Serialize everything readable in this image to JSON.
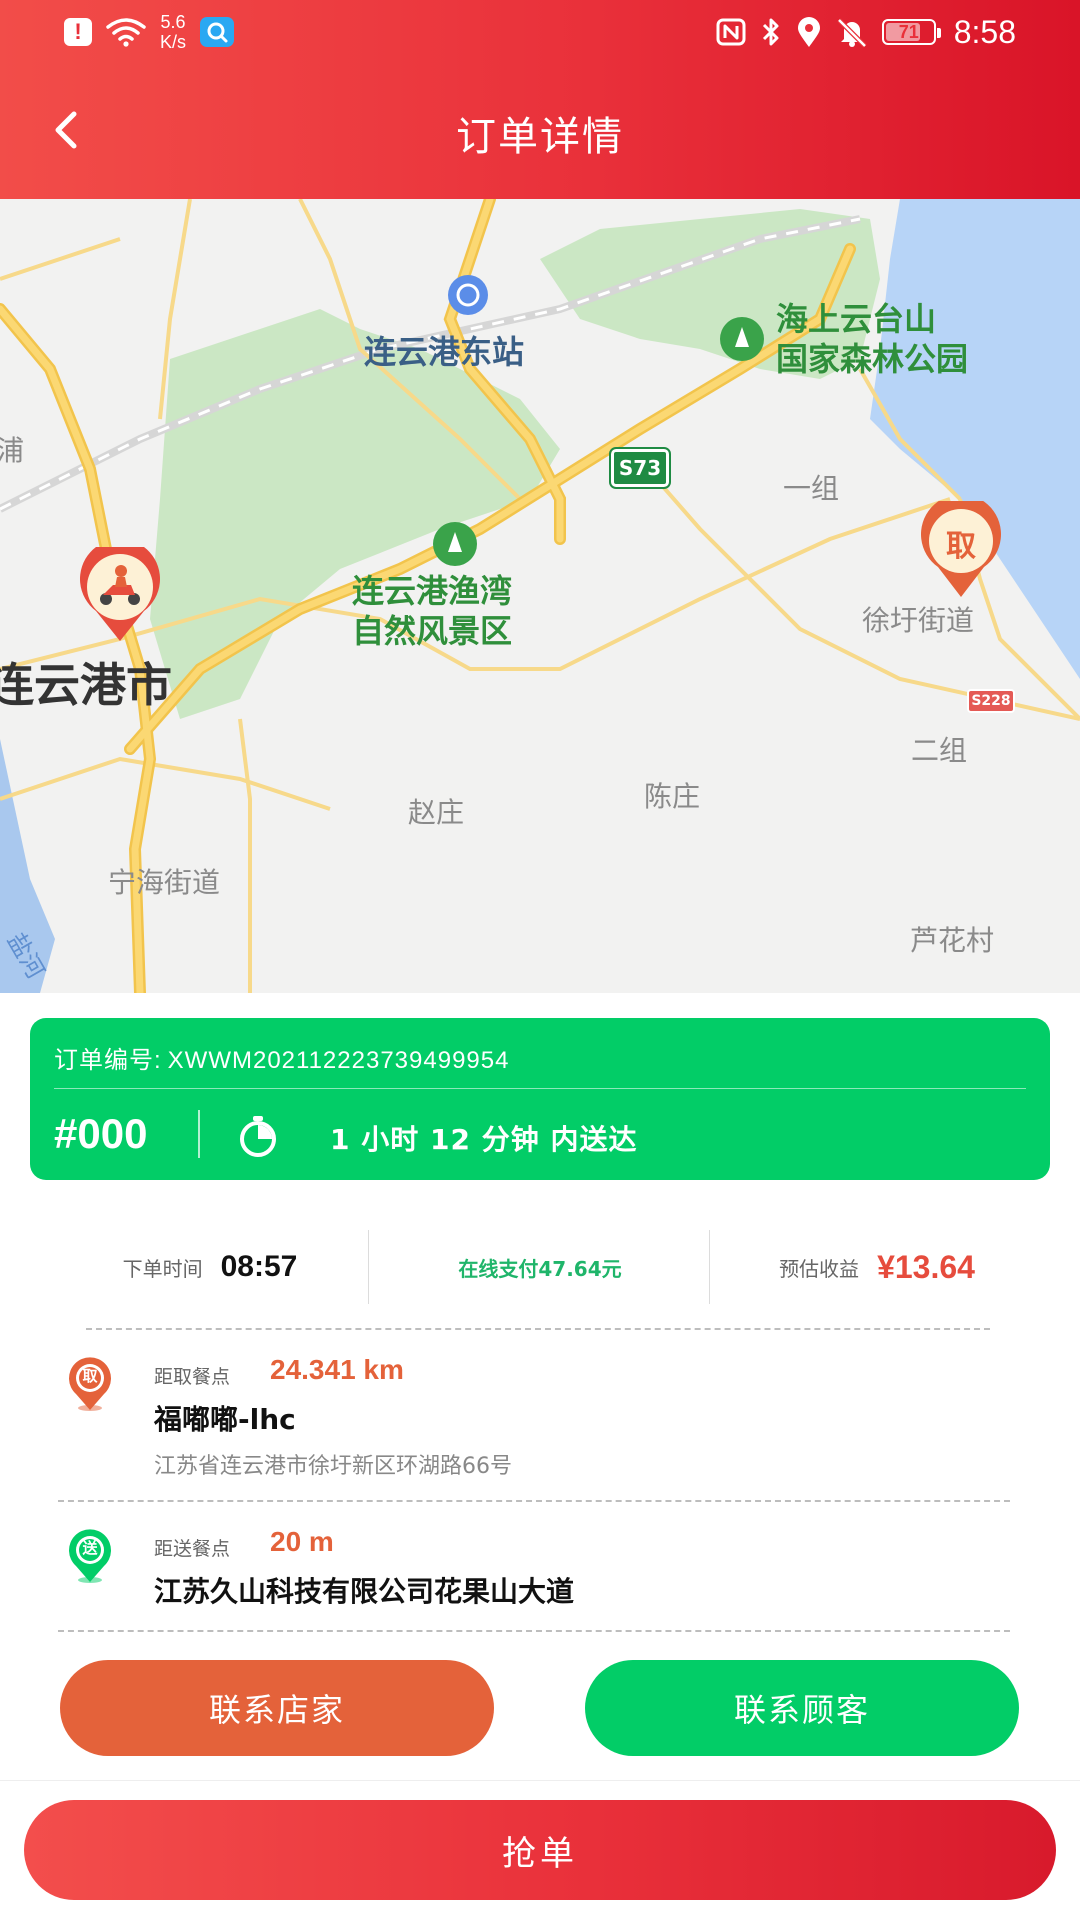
{
  "status_bar": {
    "alert_glyph": "!",
    "net_speed_value": "5.6",
    "net_speed_unit": "K/s",
    "battery_level": "71",
    "time": "8:58",
    "icons": [
      "alert-icon",
      "wifi-icon",
      "search-app-icon",
      "nfc-icon",
      "bluetooth-icon",
      "location-icon",
      "mute-icon",
      "battery-icon"
    ]
  },
  "header": {
    "title": "订单详情",
    "back_icon": "chevron-left-icon"
  },
  "map": {
    "labels": {
      "station": "连云港东站",
      "forest_park_line1": "海上云台山",
      "forest_park_line2": "国家森林公园",
      "highway": "S73",
      "highway_small": "S228",
      "yizu": "一组",
      "xuwei": "徐圩街道",
      "erzu": "二组",
      "scenic_line1": "连云港渔湾",
      "scenic_line2": "自然风景区",
      "city": "连云港市",
      "zhaozhuang": "赵庄",
      "chenzhuang": "陈庄",
      "ninghai": "宁海街道",
      "luhuacun": "芦花村",
      "pu": "浦",
      "yanhe": "盐河"
    },
    "pickup_marker_label": "取",
    "rider_marker_icon": "scooter-rider-icon"
  },
  "order": {
    "number_label": "订单编号:",
    "number": "XWWM202112223739499954",
    "sequence": "#000",
    "timer_icon": "stopwatch-icon",
    "deliver_text": "1 小时  12 分钟 内送达"
  },
  "info": {
    "order_time_label": "下单时间",
    "order_time": "08:57",
    "payment": "在线支付47.64元",
    "earnings_label": "预估收益",
    "earnings": "¥13.64"
  },
  "pickup": {
    "badge": "取",
    "distance_label": "距取餐点",
    "distance": "24.341 km",
    "name": "福嘟嘟-lhc",
    "address": "江苏省连云港市徐圩新区环湖路66号"
  },
  "delivery": {
    "badge": "送",
    "distance_label": "距送餐点",
    "distance": "20 m",
    "name": "江苏久山科技有限公司花果山大道"
  },
  "actions": {
    "contact_shop": "联系店家",
    "contact_customer": "联系顾客",
    "grab_order": "抢单"
  },
  "colors": {
    "brand_red": "#e9303a",
    "green": "#02cd67",
    "orange": "#e4623a",
    "earnings_red": "#e64c3d"
  }
}
